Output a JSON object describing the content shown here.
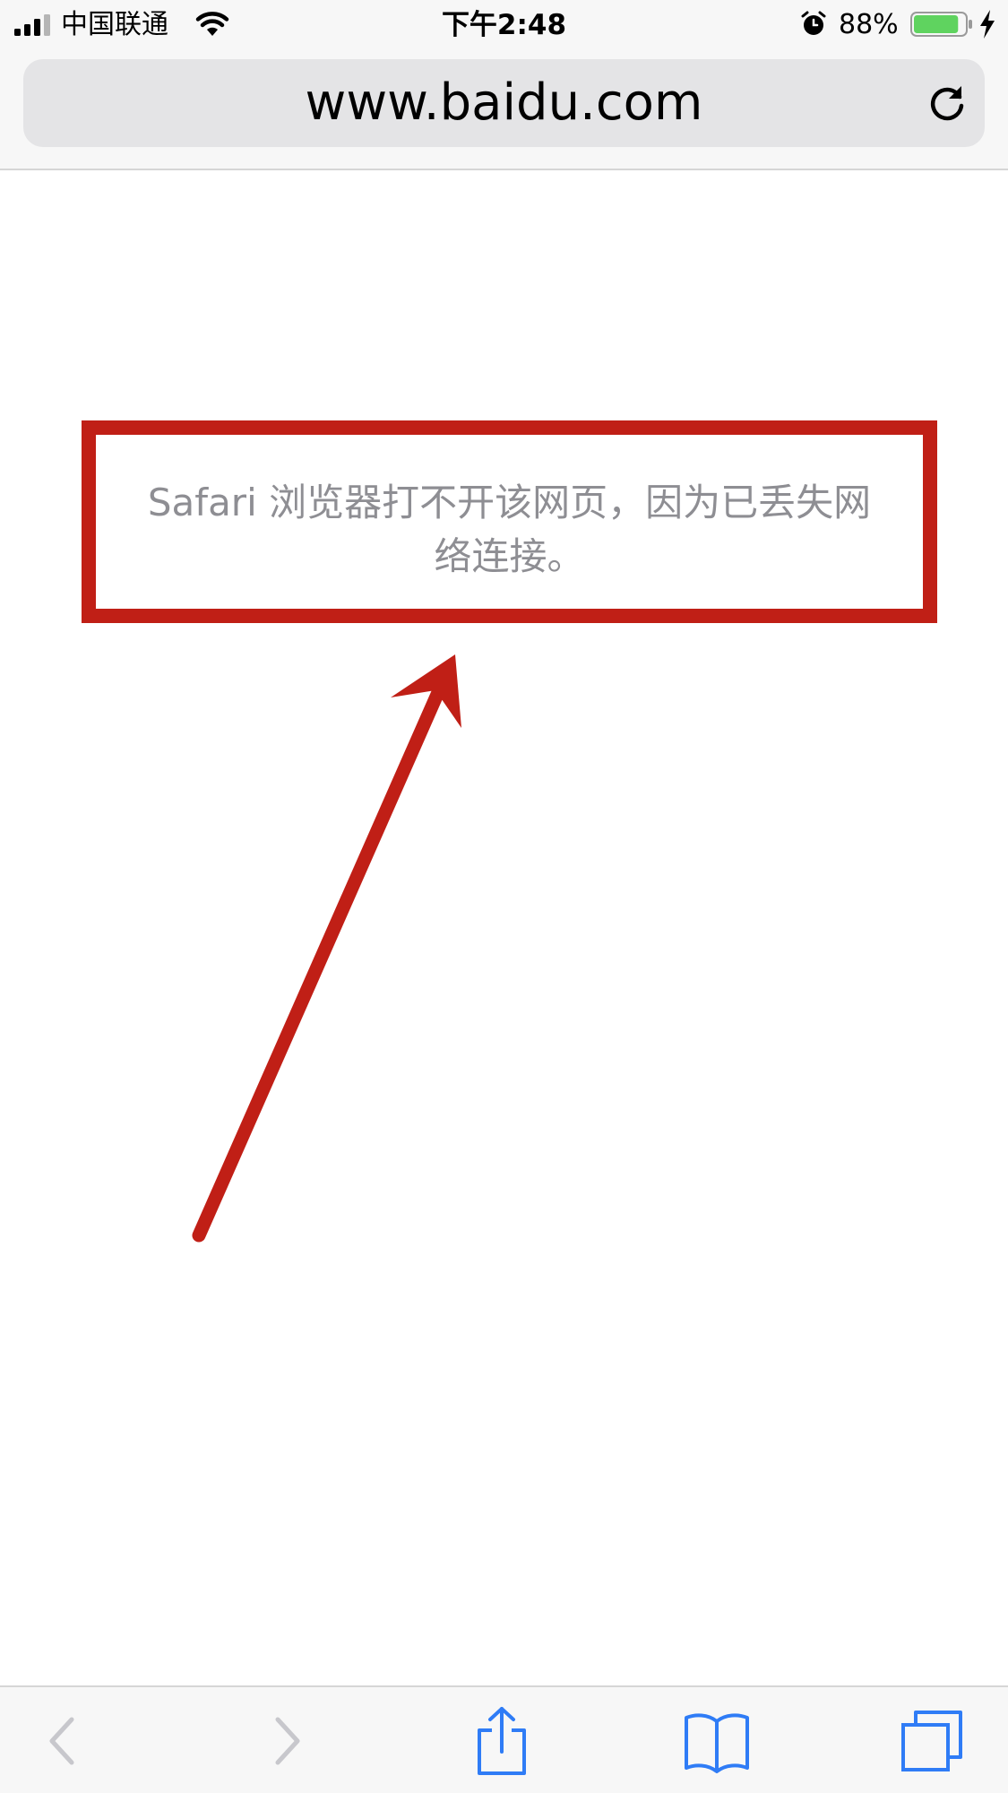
{
  "status_bar": {
    "carrier": "中国联通",
    "time": "下午2:48",
    "battery_percent": "88%",
    "battery_level": 0.88,
    "battery_color": "#5fd35f"
  },
  "address_bar": {
    "url": "www.baidu.com",
    "reload_icon": "reload-icon"
  },
  "page": {
    "error_message": "Safari 浏览器打不开该网页，因为已丢失网络连接。"
  },
  "annotation": {
    "color": "#c01f16"
  },
  "toolbar": {
    "icons": [
      "back-icon",
      "forward-icon",
      "share-icon",
      "bookmarks-icon",
      "tabs-icon"
    ],
    "active_color": "#2f7cf6",
    "disabled_color": "#c7c7cc"
  }
}
